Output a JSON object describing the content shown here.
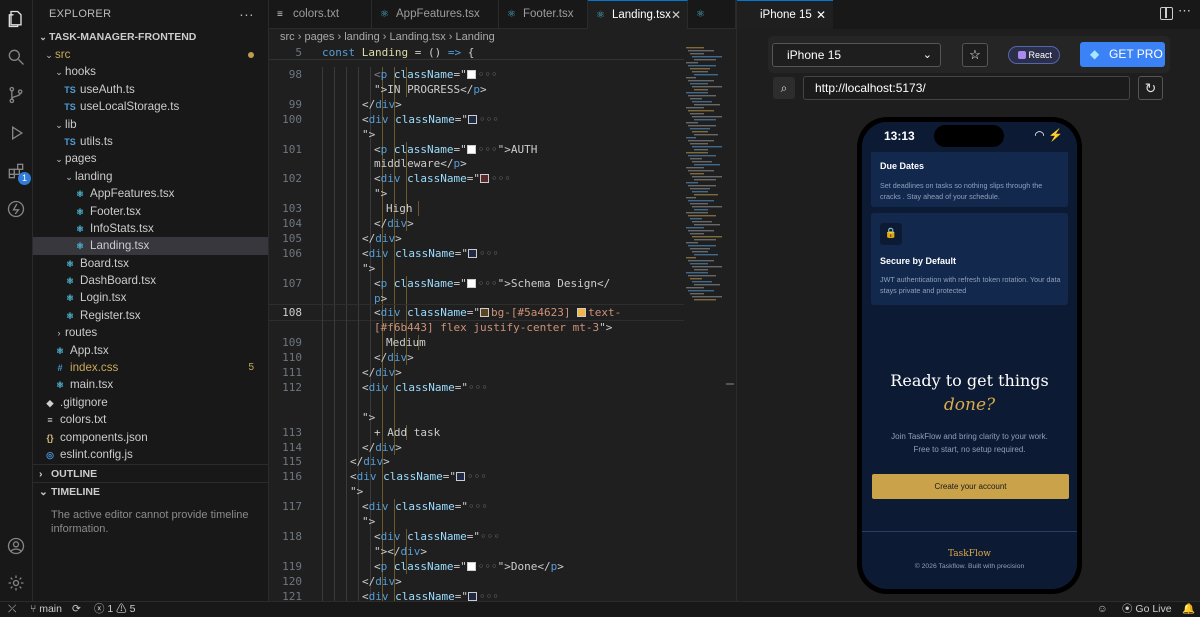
{
  "explorer": {
    "title": "EXPLORER",
    "project": "TASK-MANAGER-FRONTEND",
    "tree": [
      {
        "label": "src",
        "depth": 0,
        "type": "folder",
        "open": true,
        "modified": true
      },
      {
        "label": "hooks",
        "depth": 1,
        "type": "folder",
        "open": true
      },
      {
        "label": "useAuth.ts",
        "depth": 2,
        "type": "ts"
      },
      {
        "label": "useLocalStorage.ts",
        "depth": 2,
        "type": "ts"
      },
      {
        "label": "lib",
        "depth": 1,
        "type": "folder",
        "open": true
      },
      {
        "label": "utils.ts",
        "depth": 2,
        "type": "ts"
      },
      {
        "label": "pages",
        "depth": 1,
        "type": "folder",
        "open": true
      },
      {
        "label": "landing",
        "depth": 2,
        "type": "folder",
        "open": true
      },
      {
        "label": "AppFeatures.tsx",
        "depth": 3,
        "type": "react"
      },
      {
        "label": "Footer.tsx",
        "depth": 3,
        "type": "react"
      },
      {
        "label": "InfoStats.tsx",
        "depth": 3,
        "type": "react"
      },
      {
        "label": "Landing.tsx",
        "depth": 3,
        "type": "react",
        "selected": true
      },
      {
        "label": "Board.tsx",
        "depth": 2,
        "type": "react"
      },
      {
        "label": "DashBoard.tsx",
        "depth": 2,
        "type": "react"
      },
      {
        "label": "Login.tsx",
        "depth": 2,
        "type": "react"
      },
      {
        "label": "Register.tsx",
        "depth": 2,
        "type": "react"
      },
      {
        "label": "routes",
        "depth": 1,
        "type": "folder",
        "open": false
      },
      {
        "label": "App.tsx",
        "depth": 1,
        "type": "react"
      },
      {
        "label": "index.css",
        "depth": 1,
        "type": "css",
        "count": "5",
        "warn": true
      },
      {
        "label": "main.tsx",
        "depth": 1,
        "type": "react"
      },
      {
        "label": ".gitignore",
        "depth": 0,
        "type": "git"
      },
      {
        "label": "colors.txt",
        "depth": 0,
        "type": "txt"
      },
      {
        "label": "components.json",
        "depth": 0,
        "type": "json"
      },
      {
        "label": "eslint.config.js",
        "depth": 0,
        "type": "eslint"
      }
    ],
    "outline_label": "OUTLINE",
    "timeline_label": "TIMELINE",
    "timeline_message": "The active editor cannot provide timeline information."
  },
  "tabs": [
    {
      "label": "colors.txt",
      "active": false
    },
    {
      "label": "AppFeatures.tsx",
      "active": false
    },
    {
      "label": "Footer.tsx",
      "active": false
    },
    {
      "label": "Landing.tsx",
      "active": true
    }
  ],
  "breadcrumb": [
    "src",
    "pages",
    "landing",
    "Landing.tsx",
    "Landing"
  ],
  "code": {
    "sticky": {
      "ln": "5",
      "text": "const Landing = () => {"
    },
    "lines": [
      {
        "ln": "98",
        "html": "<span class='p'>&lt;</span><span class='t'>p</span> <span class='a'>className</span>=\"<span class='sw' style='background:#fff'></span><span class='p'>◦◦◦</span>",
        "indent": 8
      },
      {
        "ln": "",
        "html": "\"&gt;IN PROGRESS&lt;/<span class='t'>p</span>&gt;",
        "indent": 8
      },
      {
        "ln": "99",
        "html": "&lt;/<span class='t'>div</span>&gt;",
        "indent": 7
      },
      {
        "ln": "100",
        "html": "&lt;<span class='t'>div</span> <span class='a'>className</span>=\"<span class='sw' style='background:#1f2b44'></span><span class='p'>◦◦◦</span>",
        "indent": 7
      },
      {
        "ln": "",
        "html": "\"&gt;",
        "indent": 7
      },
      {
        "ln": "101",
        "html": "&lt;<span class='t'>p</span> <span class='a'>className</span>=\"<span class='sw' style='background:#fff'></span><span class='p'>◦◦◦</span>\"&gt;AUTH",
        "indent": 8
      },
      {
        "ln": "",
        "html": "middleware&lt;/<span class='t'>p</span>&gt;",
        "indent": 8
      },
      {
        "ln": "102",
        "html": "&lt;<span class='t'>div</span> <span class='a'>className</span>=\"<span class='sw' style='background:#5a2a2a'></span><span class='p'>◦◦◦</span>",
        "indent": 8
      },
      {
        "ln": "",
        "html": "\"&gt;",
        "indent": 8
      },
      {
        "ln": "103",
        "html": "High",
        "indent": 9
      },
      {
        "ln": "104",
        "html": "&lt;/<span class='t'>div</span>&gt;",
        "indent": 8
      },
      {
        "ln": "105",
        "html": "&lt;/<span class='t'>div</span>&gt;",
        "indent": 7
      },
      {
        "ln": "106",
        "html": "&lt;<span class='t'>div</span> <span class='a'>className</span>=\"<span class='sw' style='background:#1f2b44'></span><span class='p'>◦◦◦</span>",
        "indent": 7
      },
      {
        "ln": "",
        "html": "\"&gt;",
        "indent": 7
      },
      {
        "ln": "107",
        "html": "&lt;<span class='t'>p</span> <span class='a'>className</span>=\"<span class='sw' style='background:#fff'></span><span class='p'>◦◦◦</span>\"&gt;Schema Design&lt;/",
        "indent": 8
      },
      {
        "ln": "",
        "html": "<span class='t'>p</span>&gt;",
        "indent": 8
      },
      {
        "ln": "108",
        "html": "&lt;<span class='t'>div</span> <span class='a'>className</span>=\"<span class='sw' style='background:#5a4623'></span><span class='s'>bg-[#5a4623] </span><span class='sw' style='background:#f6b443'></span><span class='s'>text-</span>",
        "indent": 8,
        "current": true
      },
      {
        "ln": "",
        "html": "<span class='s'>[#f6b443] flex justify-center mt-3</span>\"&gt;",
        "indent": 8
      },
      {
        "ln": "109",
        "html": "Medium",
        "indent": 9
      },
      {
        "ln": "110",
        "html": "&lt;/<span class='t'>div</span>&gt;",
        "indent": 8
      },
      {
        "ln": "111",
        "html": "&lt;/<span class='t'>div</span>&gt;",
        "indent": 7
      },
      {
        "ln": "112",
        "html": "&lt;<span class='t'>div</span> <span class='a'>className</span>=\"<span class='p'>◦◦◦</span>",
        "indent": 7
      },
      {
        "ln": "",
        "html": "",
        "indent": 7
      },
      {
        "ln": "",
        "html": "\"&gt;",
        "indent": 7
      },
      {
        "ln": "113",
        "html": "+ Add task",
        "indent": 8
      },
      {
        "ln": "114",
        "html": "&lt;/<span class='t'>div</span>&gt;",
        "indent": 7
      },
      {
        "ln": "115",
        "html": "&lt;/<span class='t'>div</span>&gt;",
        "indent": 6
      },
      {
        "ln": "116",
        "html": "&lt;<span class='t'>div</span> <span class='a'>className</span>=\"<span class='sw' style='background:#1f2b44'></span><span class='p'>◦◦◦</span>",
        "indent": 6
      },
      {
        "ln": "",
        "html": "\"&gt;",
        "indent": 6
      },
      {
        "ln": "117",
        "html": "&lt;<span class='t'>div</span> <span class='a'>className</span>=\"<span class='p'>◦◦◦</span>",
        "indent": 7
      },
      {
        "ln": "",
        "html": "\"&gt;",
        "indent": 7
      },
      {
        "ln": "118",
        "html": "&lt;<span class='t'>div</span> <span class='a'>className</span>=\"<span class='p'>◦◦◦</span>",
        "indent": 8
      },
      {
        "ln": "",
        "html": "\"&gt;&lt;/<span class='t'>div</span>&gt;",
        "indent": 8
      },
      {
        "ln": "119",
        "html": "&lt;<span class='t'>p</span> <span class='a'>className</span>=\"<span class='sw' style='background:#fff'></span><span class='p'>◦◦◦</span>\"&gt;Done&lt;/<span class='t'>p</span>&gt;",
        "indent": 8
      },
      {
        "ln": "120",
        "html": "&lt;/<span class='t'>div</span>&gt;",
        "indent": 7
      },
      {
        "ln": "121",
        "html": "&lt;<span class='t'>div</span> <span class='a'>className</span>=\"<span class='sw' style='background:#1f2b44'></span><span class='p'>◦◦◦</span>",
        "indent": 7
      }
    ]
  },
  "preview": {
    "tab_label": "iPhone 15",
    "device": "iPhone 15",
    "react_label": "React",
    "pro_label": "GET PRO",
    "url": "http://localhost:5173/",
    "phone": {
      "time": "13:13",
      "card1_title": "Due Dates",
      "card1_desc": "Set deadlines on tasks so nothing slips through the cracks . Stay ahead of your schedule.",
      "card2_title": "Secure by Default",
      "card2_desc": "JWT authentication with refresh token rotation. Your data stays private and protected",
      "cta_title": "Ready to get things",
      "cta_accent": "done?",
      "cta_sub1": "Join TaskFlow and bring clarity to your work.",
      "cta_sub2": "Free to start, no setup required.",
      "cta_button": "Create your account",
      "footer_brand": "TaskFlow",
      "footer_copy": "© 2026 Taskflow. Built with precision"
    }
  },
  "status": {
    "branch": "main",
    "errors": "1",
    "warnings": "5",
    "go_live": "Go Live"
  }
}
